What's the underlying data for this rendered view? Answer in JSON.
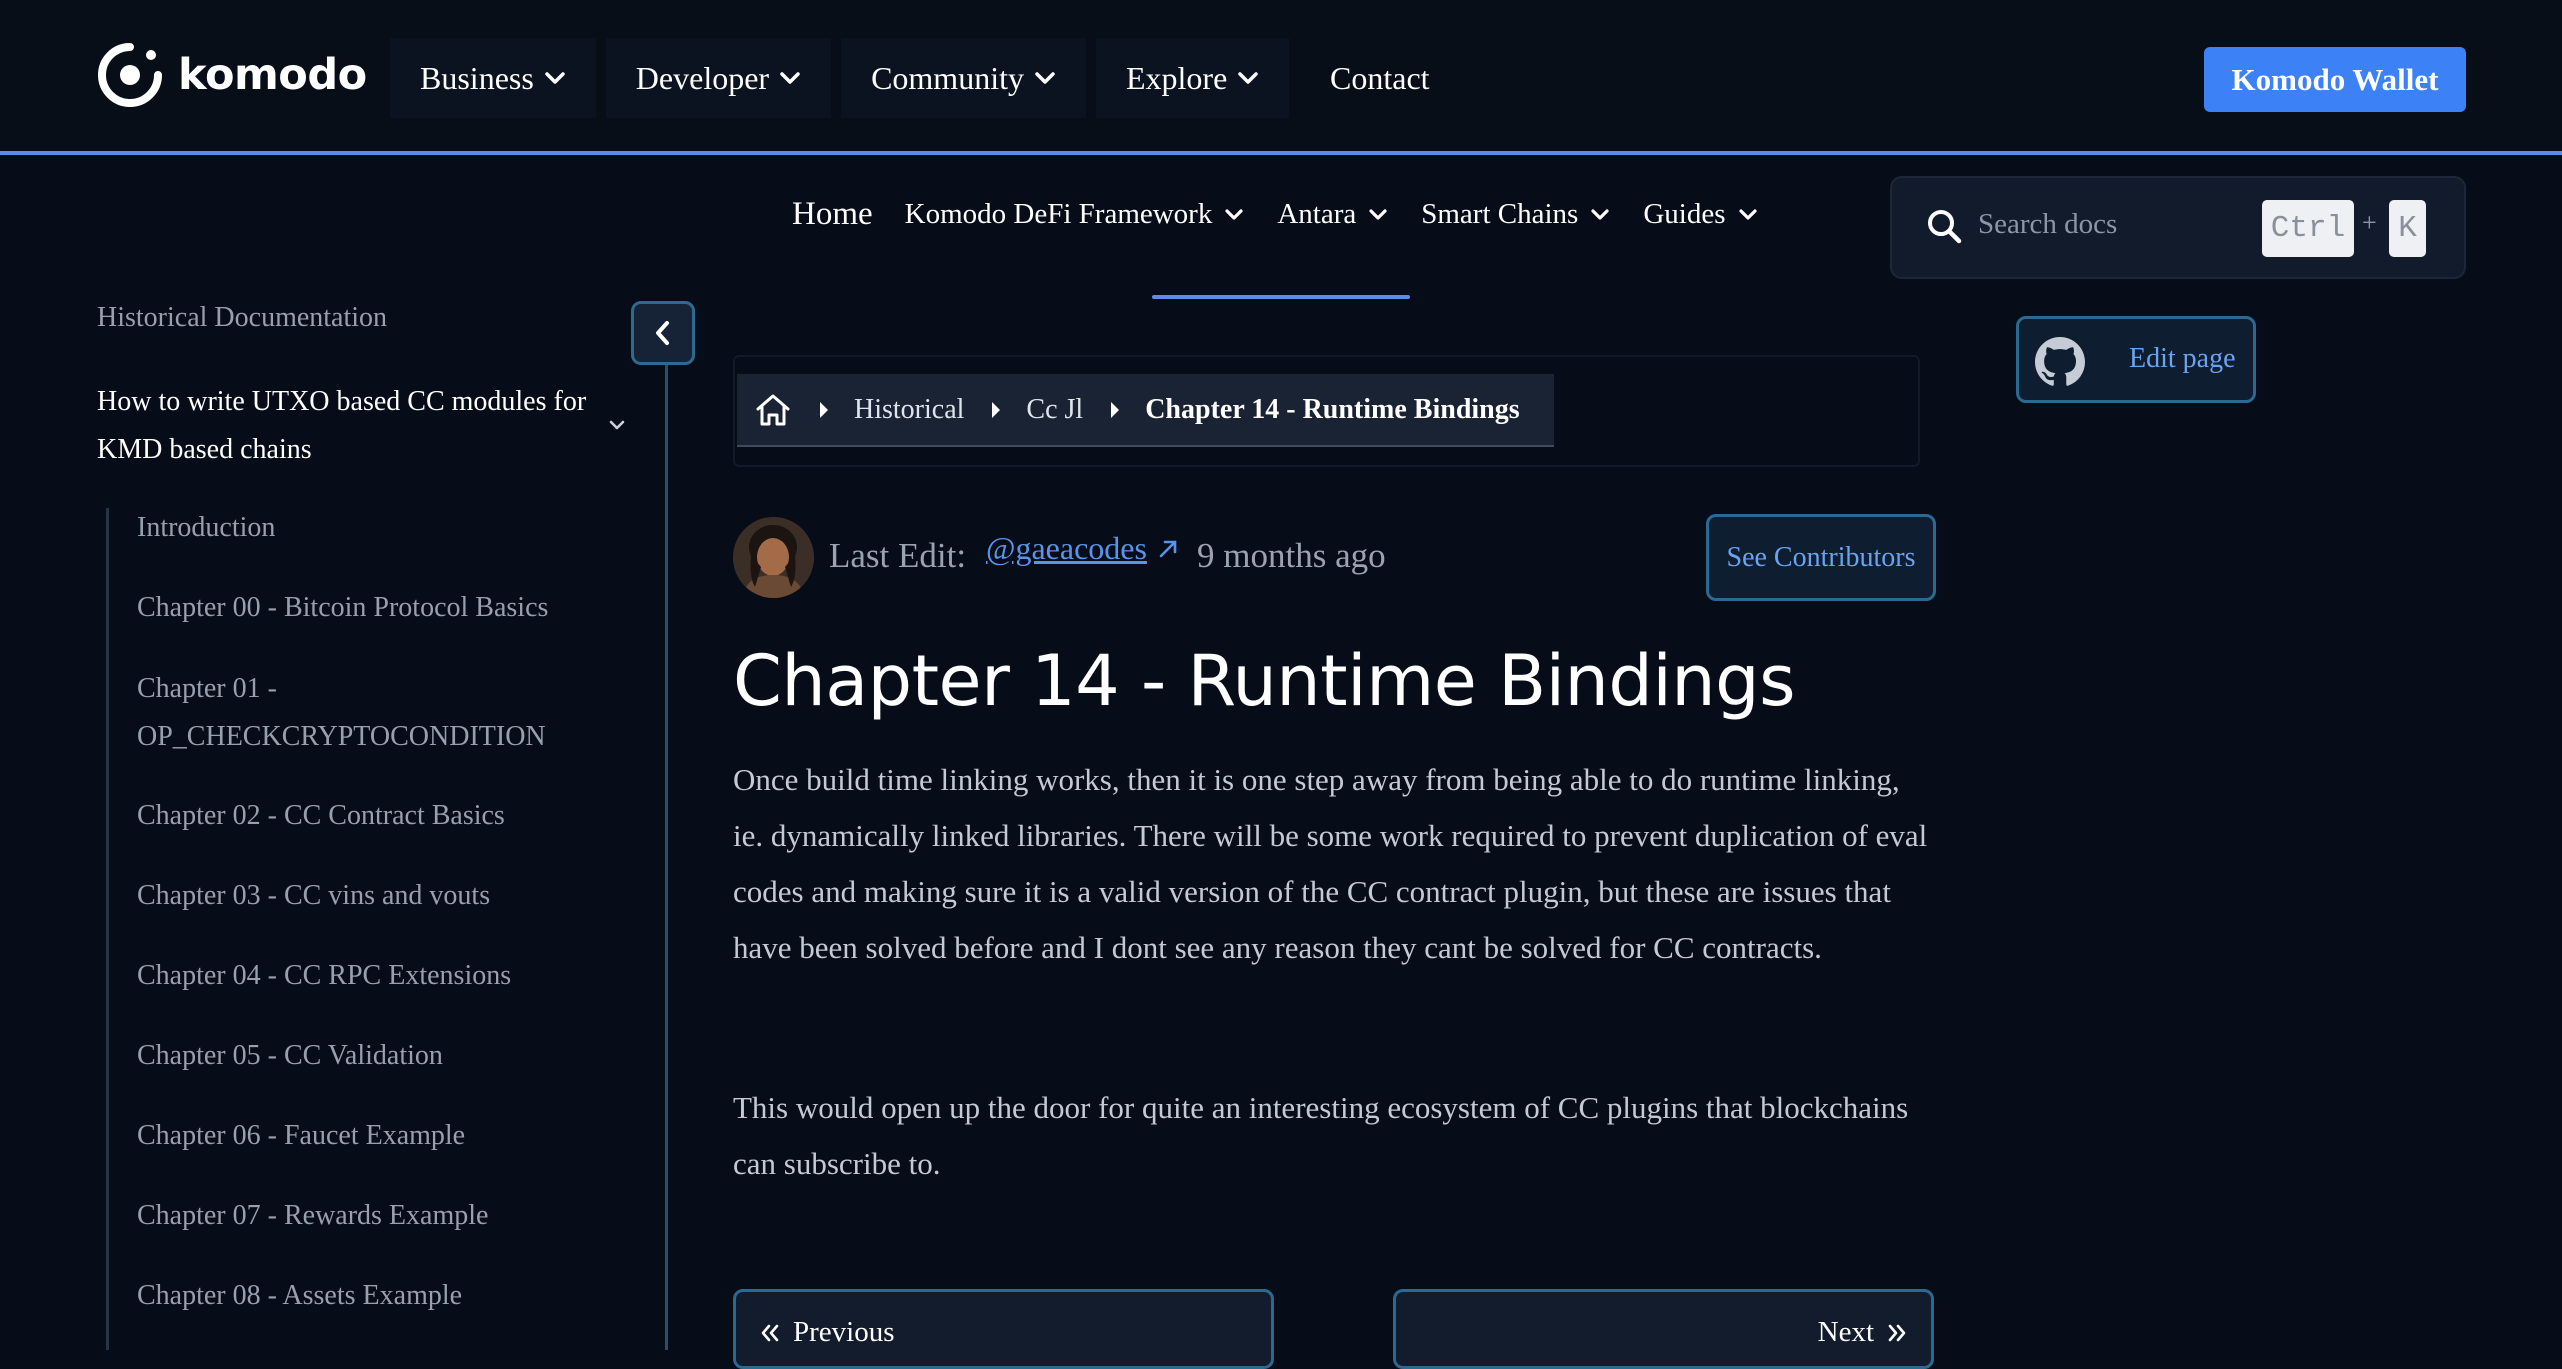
{
  "header": {
    "logo_text": "komodo",
    "nav": [
      {
        "label": "Business"
      },
      {
        "label": "Developer"
      },
      {
        "label": "Community"
      },
      {
        "label": "Explore"
      }
    ],
    "contact_label": "Contact",
    "wallet_button": "Komodo Wallet"
  },
  "docs_nav": {
    "home": "Home",
    "items": [
      {
        "label": "Komodo DeFi Framework"
      },
      {
        "label": "Antara"
      },
      {
        "label": "Smart Chains"
      },
      {
        "label": "Guides"
      }
    ]
  },
  "search": {
    "placeholder": "Search docs",
    "shortcut_key1": "Ctrl",
    "shortcut_plus": "+",
    "shortcut_key2": "K"
  },
  "sidebar": {
    "root": "Historical Documentation",
    "section": "How to write UTXO based CC modules for KMD based chains",
    "items": [
      "Introduction",
      "Chapter 00 - Bitcoin Protocol Basics",
      "Chapter 01 - OP_CHECKCRYPTOCONDITION",
      "Chapter 02 - CC Contract Basics",
      "Chapter 03 - CC vins and vouts",
      "Chapter 04 - CC RPC Extensions",
      "Chapter 05 - CC Validation",
      "Chapter 06 - Faucet Example",
      "Chapter 07 - Rewards Example",
      "Chapter 08 - Assets Example"
    ]
  },
  "edit_page": "Edit page",
  "breadcrumb": {
    "items": [
      "Historical",
      "Cc Jl"
    ],
    "current": "Chapter 14 - Runtime Bindings"
  },
  "last_edit": {
    "label": "Last Edit:",
    "author": "@gaeacodes",
    "time": "9 months ago",
    "contributors_button": "See Contributors"
  },
  "article": {
    "title": "Chapter 14 - Runtime Bindings",
    "paragraphs": [
      "Once build time linking works, then it is one step away from being able to do runtime linking, ie. dynamically linked libraries. There will be some work required to prevent duplication of eval codes and making sure it is a valid version of the CC contract plugin, but these are issues that have been solved before and I dont see any reason they cant be solved for CC contracts.",
      "This would open up the door for quite an interesting ecosystem of CC plugins that blockchains can subscribe to."
    ]
  },
  "pager": {
    "previous": "Previous",
    "next": "Next"
  },
  "colors": {
    "background": "#070d18",
    "accent": "#3c82f6",
    "link": "#5a93e8",
    "border": "#2a6a92"
  }
}
